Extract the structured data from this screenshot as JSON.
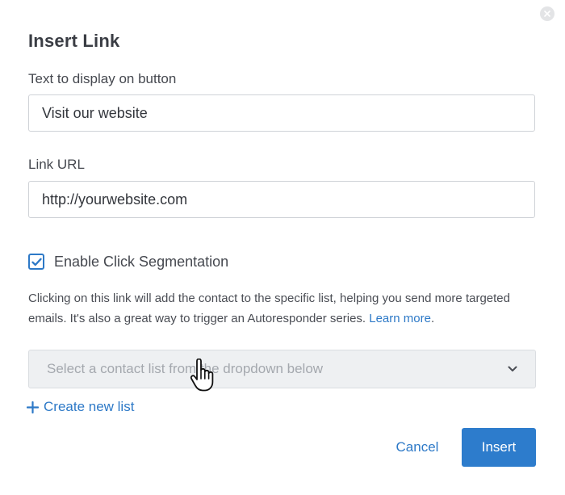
{
  "dialog": {
    "title": "Insert Link",
    "close_icon": "close-icon"
  },
  "display_text": {
    "label": "Text to display on button",
    "value": "Visit our website"
  },
  "link_url": {
    "label": "Link URL",
    "value": "http://yourwebsite.com"
  },
  "segmentation": {
    "checked": true,
    "label": "Enable Click Segmentation",
    "help_text": "Clicking on this link will add the contact to the specific list, helping you send more targeted emails. It's also a great way to trigger an Autoresponder series.",
    "learn_more": "Learn more",
    "help_suffix": "."
  },
  "contact_list": {
    "placeholder": "Select a contact list from the dropdown below",
    "icon": "chevron-down-icon"
  },
  "create_list": {
    "label": "Create new list",
    "icon": "plus-icon"
  },
  "actions": {
    "cancel": "Cancel",
    "insert": "Insert"
  },
  "colors": {
    "accent": "#2d7ccc",
    "link": "#2d79c7",
    "dropdown_bg": "#eef0f2"
  }
}
